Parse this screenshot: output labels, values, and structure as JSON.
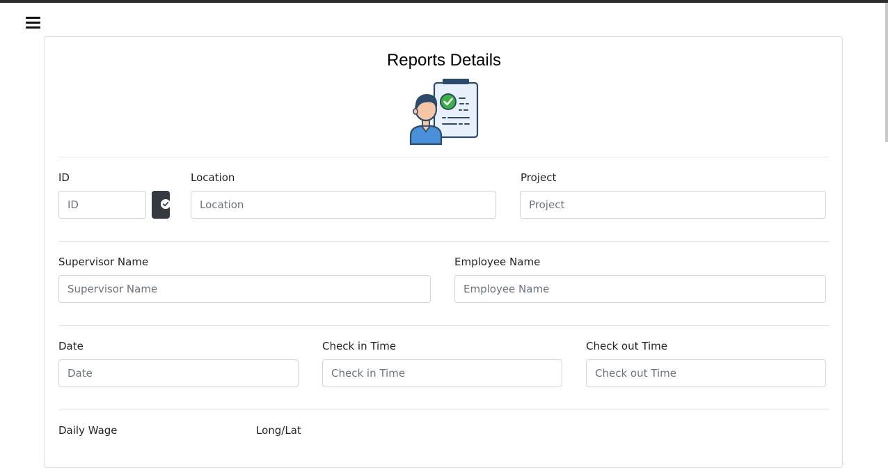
{
  "header": {
    "menu_icon": "hamburger-menu-icon"
  },
  "page": {
    "title": "Reports Details",
    "illustration_icon": "employee-report-clipboard-icon"
  },
  "form": {
    "id": {
      "label": "ID",
      "placeholder": "ID",
      "verify_icon": "check-circle-icon"
    },
    "location": {
      "label": "Location",
      "placeholder": "Location"
    },
    "project": {
      "label": "Project",
      "placeholder": "Project"
    },
    "supervisor_name": {
      "label": "Supervisor Name",
      "placeholder": "Supervisor Name"
    },
    "employee_name": {
      "label": "Employee Name",
      "placeholder": "Employee Name"
    },
    "date": {
      "label": "Date",
      "placeholder": "Date"
    },
    "check_in_time": {
      "label": "Check in Time",
      "placeholder": "Check in Time"
    },
    "check_out_time": {
      "label": "Check out Time",
      "placeholder": "Check out Time"
    },
    "daily_wage": {
      "label": "Daily Wage"
    },
    "long_lat": {
      "label": "Long/Lat"
    }
  },
  "colors": {
    "verify_button": "#343a40",
    "border": "#ced4da",
    "placeholder": "#6c757d",
    "check_green": "#3cb043"
  }
}
